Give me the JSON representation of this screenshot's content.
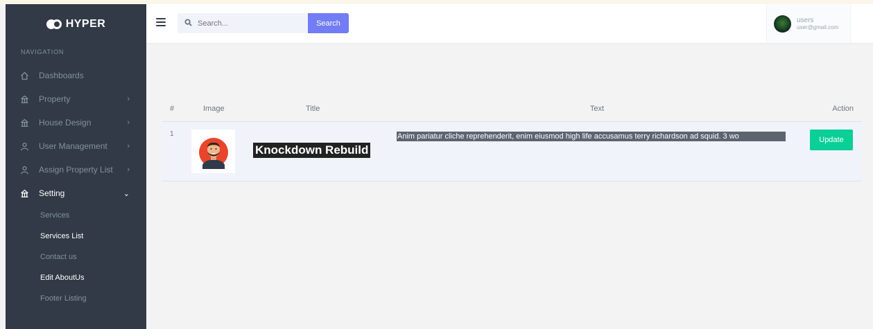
{
  "brand": {
    "name": "HYPER"
  },
  "sidebar": {
    "section_title": "NAVIGATION",
    "items": [
      {
        "label": "Dashboards",
        "icon": "home-icon",
        "has_chevron": false
      },
      {
        "label": "Property",
        "icon": "building-icon",
        "has_chevron": true
      },
      {
        "label": "House Design",
        "icon": "building-icon",
        "has_chevron": true
      },
      {
        "label": "User Management",
        "icon": "user-icon",
        "has_chevron": true
      },
      {
        "label": "Assign Property List",
        "icon": "user-icon",
        "has_chevron": true
      },
      {
        "label": "Setting",
        "icon": "building-icon",
        "has_chevron": true,
        "expanded": true
      }
    ],
    "chevron_right": "›",
    "chevron_down": "⌄",
    "sub_items": [
      {
        "label": "Services"
      },
      {
        "label": "Services List",
        "active": true
      },
      {
        "label": "Contact us"
      },
      {
        "label": "Edit AboutUs",
        "active": true
      },
      {
        "label": "Footer Listing"
      }
    ]
  },
  "topbar": {
    "search": {
      "placeholder": "Search...",
      "value": "",
      "button_label": "Search"
    },
    "user": {
      "name": "users",
      "email": "user@gmail.com"
    }
  },
  "table": {
    "headers": {
      "num": "#",
      "image": "Image",
      "title": "Title",
      "text": "Text",
      "action": "Action"
    },
    "rows": [
      {
        "num": "1",
        "title": "Knockdown Rebuild",
        "text": "Anim pariatur cliche reprehenderit, enim eiusmod high life accusamus terry richardson ad squid. 3 wo",
        "action_label": "Update"
      }
    ]
  },
  "colors": {
    "sidebar_bg": "#313a46",
    "primary": "#727cf5",
    "success": "#0acf97",
    "page_bg": "#f3f3f4"
  }
}
